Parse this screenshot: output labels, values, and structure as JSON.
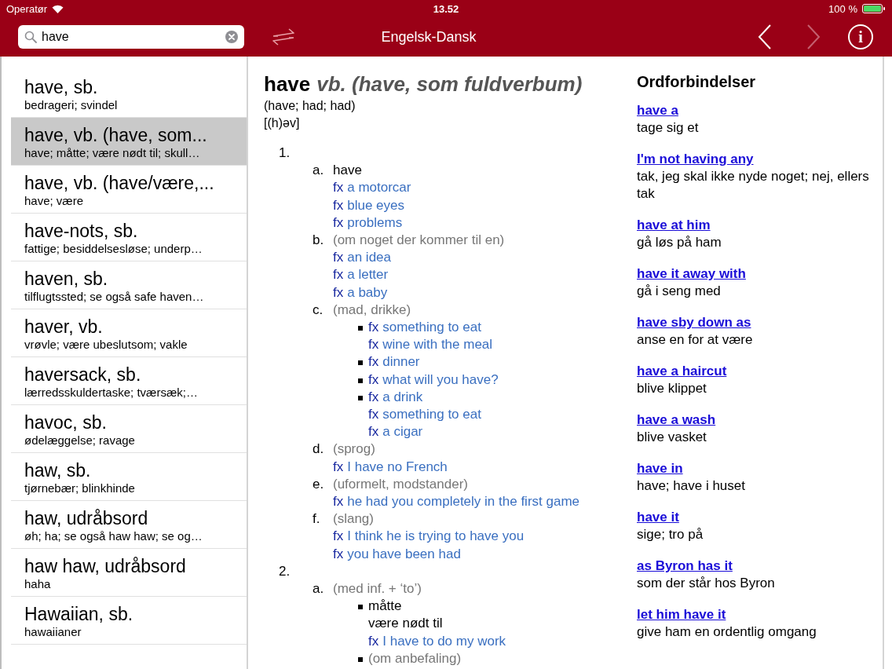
{
  "status_bar": {
    "carrier": "Operatør",
    "time": "13.52",
    "battery": "100 %"
  },
  "nav_bar": {
    "search": {
      "value": "have"
    },
    "title": "Engelsk-Dansk",
    "back_enabled": true,
    "forward_enabled": false,
    "info_label": "i"
  },
  "results": [
    {
      "title": "have, sb.",
      "subtitle": "bedrageri; svindel",
      "selected": false
    },
    {
      "title": "have, vb. (have, som...",
      "subtitle": "have; måtte; være nødt til; skull…",
      "selected": true
    },
    {
      "title": "have, vb. (have/være,...",
      "subtitle": "have; være",
      "selected": false
    },
    {
      "title": "have-nots, sb.",
      "subtitle": "fattige; besiddelsesløse; underp…",
      "selected": false
    },
    {
      "title": "haven, sb.",
      "subtitle": "tilflugtssted; se også safe haven…",
      "selected": false
    },
    {
      "title": "haver, vb.",
      "subtitle": "vrøvle; være ubeslutsom; vakle",
      "selected": false
    },
    {
      "title": "haversack, sb.",
      "subtitle": "lærredsskuldertaske; tværsæk;…",
      "selected": false
    },
    {
      "title": "havoc, sb.",
      "subtitle": "ødelæggelse; ravage",
      "selected": false
    },
    {
      "title": "haw, sb.",
      "subtitle": "tjørnebær; blinkhinde",
      "selected": false
    },
    {
      "title": "haw, udråbsord",
      "subtitle": "øh; ha; se også haw haw; se og…",
      "selected": false
    },
    {
      "title": "haw haw, udråbsord",
      "subtitle": "haha",
      "selected": false
    },
    {
      "title": "Hawaiian, sb.",
      "subtitle": "hawaiianer",
      "selected": false
    }
  ],
  "entry": {
    "headword": "have",
    "pos": "vb. (have, som fuldverbum)",
    "forms": "(have; had; had)",
    "pronunciation": "[(h)əv]",
    "senses": [
      {
        "number": "1.",
        "subs": [
          {
            "letter": "a.",
            "label": {
              "kind": "gloss",
              "text": "have"
            },
            "lines": [
              {
                "kind": "example",
                "marker": "fx",
                "text": "a motorcar"
              },
              {
                "kind": "example",
                "marker": "fx",
                "text": "blue eyes"
              },
              {
                "kind": "example",
                "marker": "fx",
                "text": "problems"
              }
            ]
          },
          {
            "letter": "b.",
            "label": {
              "kind": "note",
              "text": "(om noget der kommer til en)"
            },
            "lines": [
              {
                "kind": "example",
                "marker": "fx",
                "text": "an idea"
              },
              {
                "kind": "example",
                "marker": "fx",
                "text": "a letter"
              },
              {
                "kind": "example",
                "marker": "fx",
                "text": "a baby"
              }
            ]
          },
          {
            "letter": "c.",
            "label": {
              "kind": "note",
              "text": "(mad, drikke)"
            },
            "items": [
              {
                "lines": [
                  {
                    "kind": "example",
                    "marker": "fx",
                    "text": "something to eat"
                  },
                  {
                    "kind": "example",
                    "marker": "fx",
                    "text": "wine with the meal"
                  }
                ]
              },
              {
                "lines": [
                  {
                    "kind": "example",
                    "marker": "fx",
                    "text": "dinner"
                  }
                ]
              },
              {
                "lines": [
                  {
                    "kind": "example",
                    "marker": "fx",
                    "text": "what will you have?"
                  }
                ]
              },
              {
                "lines": [
                  {
                    "kind": "example",
                    "marker": "fx",
                    "text": "a drink"
                  },
                  {
                    "kind": "example",
                    "marker": "fx",
                    "text": "something to eat"
                  },
                  {
                    "kind": "example",
                    "marker": "fx",
                    "text": "a cigar"
                  }
                ]
              }
            ]
          },
          {
            "letter": "d.",
            "label": {
              "kind": "note",
              "text": "(sprog)"
            },
            "lines": [
              {
                "kind": "example",
                "marker": "fx",
                "text": "I have no French"
              }
            ]
          },
          {
            "letter": "e.",
            "label": {
              "kind": "note",
              "text": "(uformelt, modstander)"
            },
            "lines": [
              {
                "kind": "example",
                "marker": "fx",
                "text": "he had you completely in the first game"
              }
            ]
          },
          {
            "letter": "f.",
            "label": {
              "kind": "note",
              "text": "(slang)"
            },
            "lines": [
              {
                "kind": "example",
                "marker": "fx",
                "text": "I think he is trying to have you"
              },
              {
                "kind": "example",
                "marker": "fx",
                "text": "you have been had"
              }
            ]
          }
        ]
      },
      {
        "number": "2.",
        "subs": [
          {
            "letter": "a.",
            "label": {
              "kind": "note",
              "text": "(med inf. + ‘to’)"
            },
            "items": [
              {
                "lines": [
                  {
                    "kind": "gloss",
                    "text": "måtte"
                  },
                  {
                    "kind": "gloss",
                    "text": "være nødt til"
                  },
                  {
                    "kind": "example",
                    "marker": "fx",
                    "text": "I have to do my work"
                  }
                ]
              },
              {
                "lines": [
                  {
                    "kind": "note",
                    "text": "(om anbefaling)"
                  }
                ]
              }
            ]
          }
        ]
      }
    ]
  },
  "phrases": {
    "heading": "Ordforbindelser",
    "items": [
      {
        "phrase": "have a",
        "meaning": "tage sig et"
      },
      {
        "phrase": "I'm not having any",
        "meaning": "tak, jeg skal ikke nyde noget; nej, ellers tak"
      },
      {
        "phrase": "have at him",
        "meaning": "gå løs på ham"
      },
      {
        "phrase": "have it away with",
        "meaning": "gå i seng med"
      },
      {
        "phrase": "have sby down as",
        "meaning": "anse en for at være"
      },
      {
        "phrase": "have a haircut",
        "meaning": "blive klippet"
      },
      {
        "phrase": "have a wash",
        "meaning": "blive vasket"
      },
      {
        "phrase": "have in",
        "meaning": "have; have i huset"
      },
      {
        "phrase": "have it",
        "meaning": "sige; tro på"
      },
      {
        "phrase": "as Byron has it",
        "meaning": "som der står hos Byron"
      },
      {
        "phrase": "let him have it",
        "meaning": "give ham en ordentlig omgang"
      }
    ]
  }
}
